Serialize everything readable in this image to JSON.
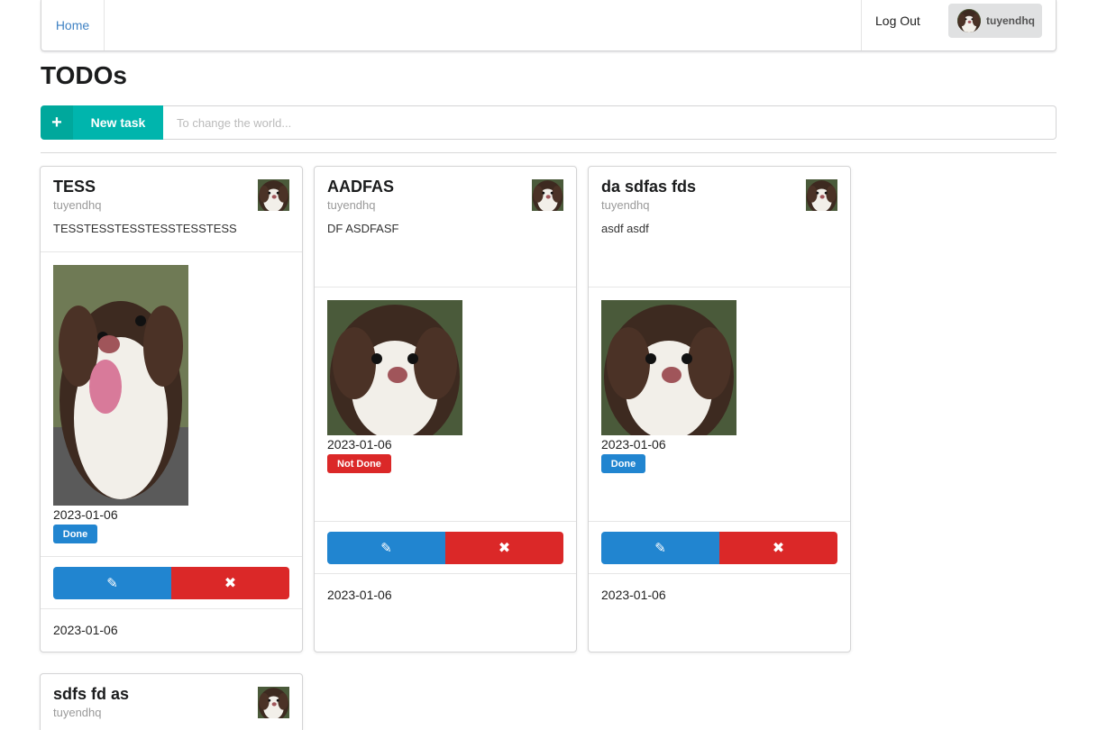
{
  "nav": {
    "home_label": "Home",
    "logout_label": "Log Out",
    "username": "tuyendhq"
  },
  "page": {
    "title": "TODOs"
  },
  "new_task": {
    "button_label": "New task",
    "plus_symbol": "+",
    "placeholder": "To change the world...",
    "value": ""
  },
  "icons": {
    "edit": "pencil-icon",
    "delete": "close-icon",
    "add": "plus-icon"
  },
  "colors": {
    "accent": "#00b5ad",
    "done": "#2185d0",
    "not_done": "#db2828",
    "link": "#4183c4"
  },
  "cards": [
    {
      "title": "TESS",
      "author": "tuyendhq",
      "description": "TESSTESSTESSTESSTESSTESS",
      "date": "2023-01-06",
      "status": "Done",
      "footer_date": "2023-01-06",
      "edit_symbol": "✎",
      "delete_symbol": "✖"
    },
    {
      "title": "AADFAS",
      "author": "tuyendhq",
      "description": "DF ASDFASF",
      "date": "2023-01-06",
      "status": "Not Done",
      "footer_date": "2023-01-06",
      "edit_symbol": "✎",
      "delete_symbol": "✖"
    },
    {
      "title": "da sdfas fds",
      "author": "tuyendhq",
      "description": "asdf asdf",
      "date": "2023-01-06",
      "status": "Done",
      "footer_date": "2023-01-06",
      "edit_symbol": "✎",
      "delete_symbol": "✖"
    },
    {
      "title": "sdfs fd as",
      "author": "tuyendhq"
    }
  ]
}
